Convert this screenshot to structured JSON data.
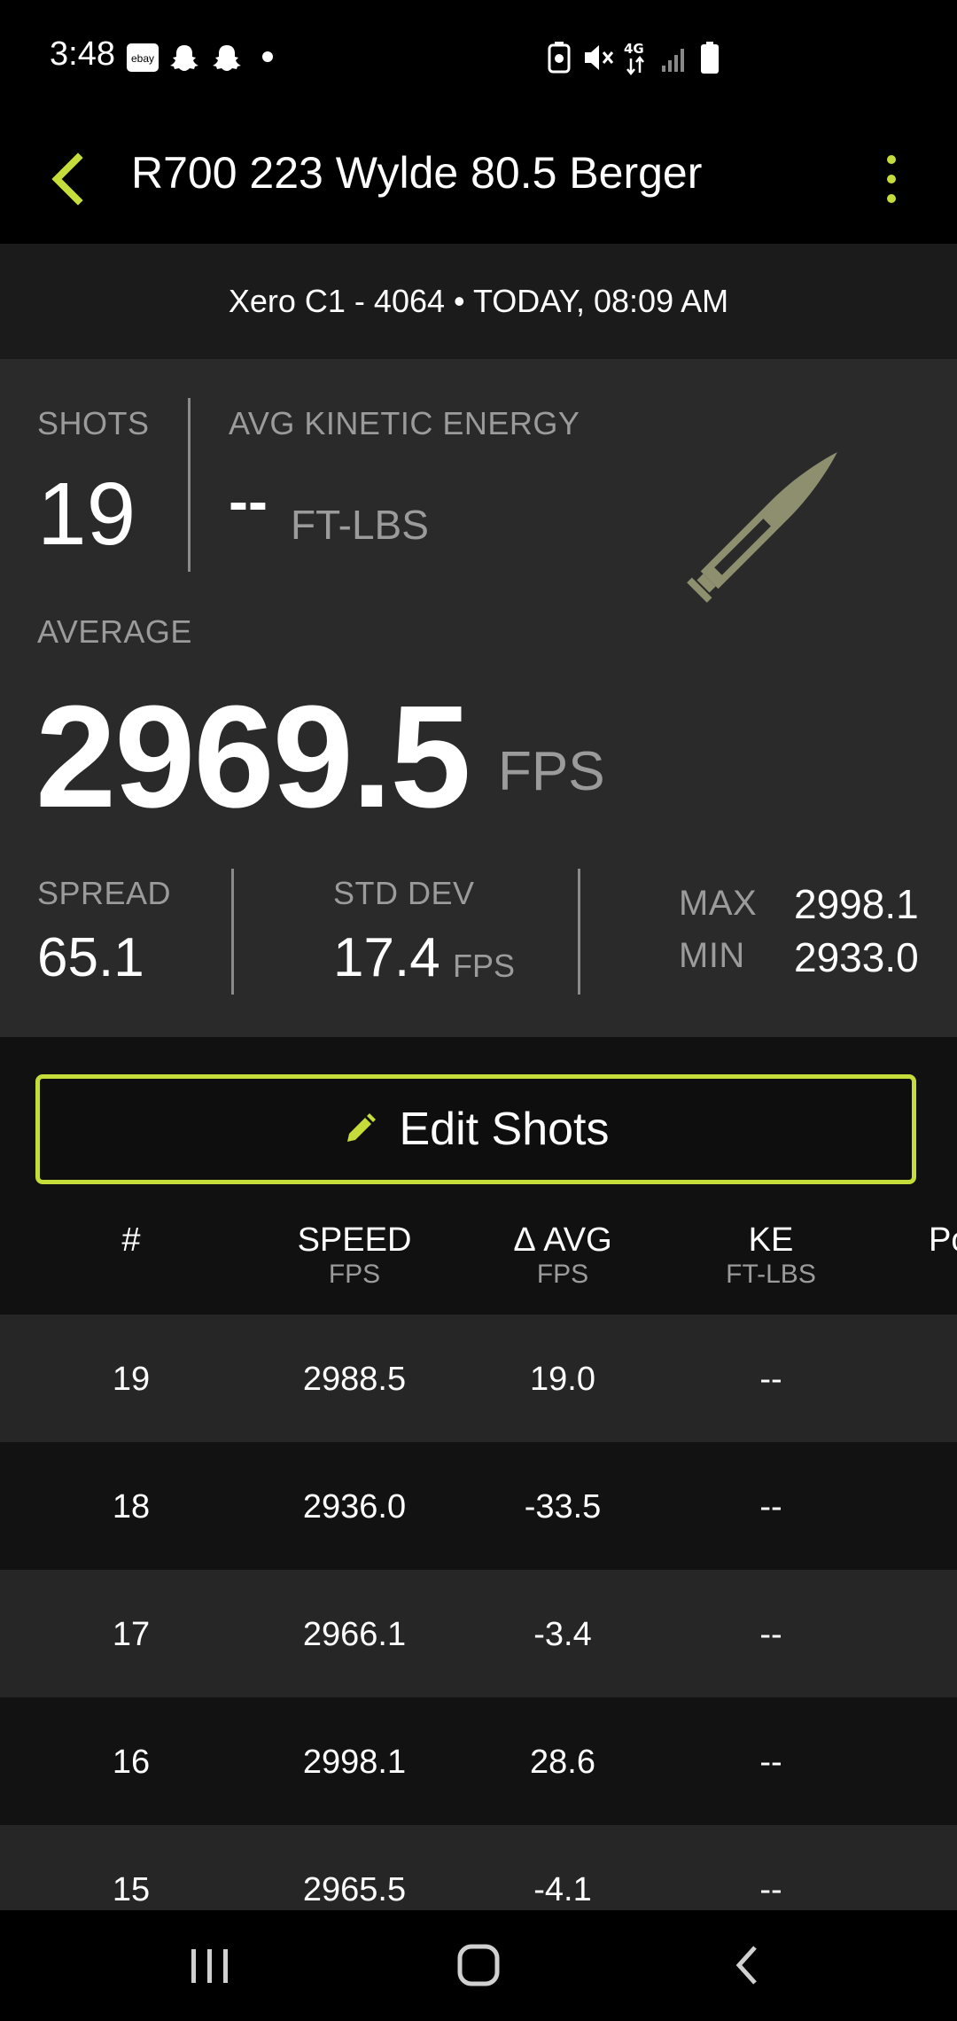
{
  "status_bar": {
    "time": "3:48",
    "notifications": [
      "ebay-icon",
      "snapchat-icon",
      "snapchat-icon",
      "dot-icon"
    ],
    "system_icons": [
      "nfc-icon",
      "mute-icon",
      "4g-icon",
      "signal-icon",
      "battery-icon"
    ],
    "ebay_text": "ebay"
  },
  "app_bar": {
    "title": "R700 223 Wylde 80.5 Berger",
    "accent_color": "#c6dc3b"
  },
  "device_line": "Xero C1 - 4064 • TODAY, 08:09 AM",
  "stats": {
    "shots_label": "SHOTS",
    "shots_value": "19",
    "ke_label": "AVG KINETIC ENERGY",
    "ke_value": "--",
    "ke_unit": "FT-LBS",
    "average_label": "AVERAGE",
    "average_value": "2969.5",
    "average_unit": "FPS",
    "spread_label": "SPREAD",
    "spread_value": "65.1",
    "std_dev_label": "STD DEV",
    "std_dev_value": "17.4",
    "std_dev_unit": "FPS",
    "max_label": "MAX",
    "max_value": "2998.1",
    "min_label": "MIN",
    "min_value": "2933.0",
    "icon": "bullet-icon"
  },
  "edit_button": {
    "label": "Edit Shots",
    "icon": "pencil-icon"
  },
  "table": {
    "headers": [
      {
        "label": "#",
        "unit": ""
      },
      {
        "label": "SPEED",
        "unit": "FPS"
      },
      {
        "label": "Δ AVG",
        "unit": "FPS"
      },
      {
        "label": "KE",
        "unit": "FT-LBS"
      },
      {
        "label": "Po",
        "unit": ""
      }
    ],
    "rows": [
      [
        "19",
        "2988.5",
        "19.0",
        "--"
      ],
      [
        "18",
        "2936.0",
        "-33.5",
        "--"
      ],
      [
        "17",
        "2966.1",
        "-3.4",
        "--"
      ],
      [
        "16",
        "2998.1",
        "28.6",
        "--"
      ],
      [
        "15",
        "2965.5",
        "-4.1",
        "--"
      ]
    ]
  },
  "nav_bar": {
    "items": [
      "recent-apps-icon",
      "home-icon",
      "back-icon"
    ]
  }
}
